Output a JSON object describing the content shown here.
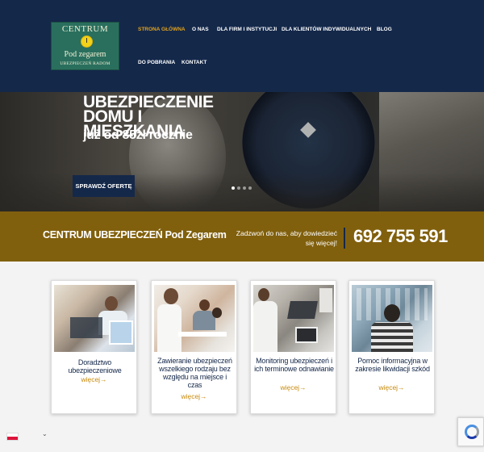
{
  "logo": {
    "line1": "CENTRUM",
    "line2": "Pod zegarem",
    "line3": "UBEZPIECZEŃ RADOM"
  },
  "nav": {
    "items": [
      {
        "label": "STRONA GŁÓWNA",
        "active": true
      },
      {
        "label": "O NAS"
      },
      {
        "label": "DLA FIRM I INSTYTUCJI"
      },
      {
        "label": "DLA KLIENTÓW INDYWIDUALNYCH"
      },
      {
        "label": "BLOG"
      },
      {
        "label": "DO POBRANIA"
      },
      {
        "label": "KONTAKT"
      }
    ]
  },
  "hero": {
    "title": "UBEZPIECZENIE DOMU I MIESZKANIA",
    "subtitle": "już od 85zł rocznie",
    "cta": "SPRAWDŹ OFERTĘ",
    "slides": 4,
    "active_slide": 1
  },
  "band": {
    "company": "CENTRUM UBEZPIECZEŃ Pod Zegarem",
    "call_text": "Zadzwoń do nas, aby dowiedzieć się więcej!",
    "phone": "692 755 591"
  },
  "cards": [
    {
      "title": "Doradztwo ubezpieczeniowe",
      "more": "więcej→"
    },
    {
      "title": "Zawieranie ubezpieczeń wszelkiego rodzaju bez względu na miejsce i czas",
      "more": "więcej→"
    },
    {
      "title": "Monitoring ubezpieczeń i ich terminowe odnawianie",
      "more": "więcej→"
    },
    {
      "title": "Pomoc informacyjna w zakresie likwidacji szkód",
      "more": "więcej→"
    }
  ],
  "colors": {
    "navy": "#14284a",
    "gold_band": "#81600d",
    "accent": "#e0a21e",
    "link": "#c88a0a"
  },
  "icons": {
    "lang_flag": "poland-flag-icon",
    "lang_chevron": "chevron-down-icon",
    "recaptcha": "recaptcha-icon"
  },
  "lang": {
    "chevron": "⌄"
  }
}
